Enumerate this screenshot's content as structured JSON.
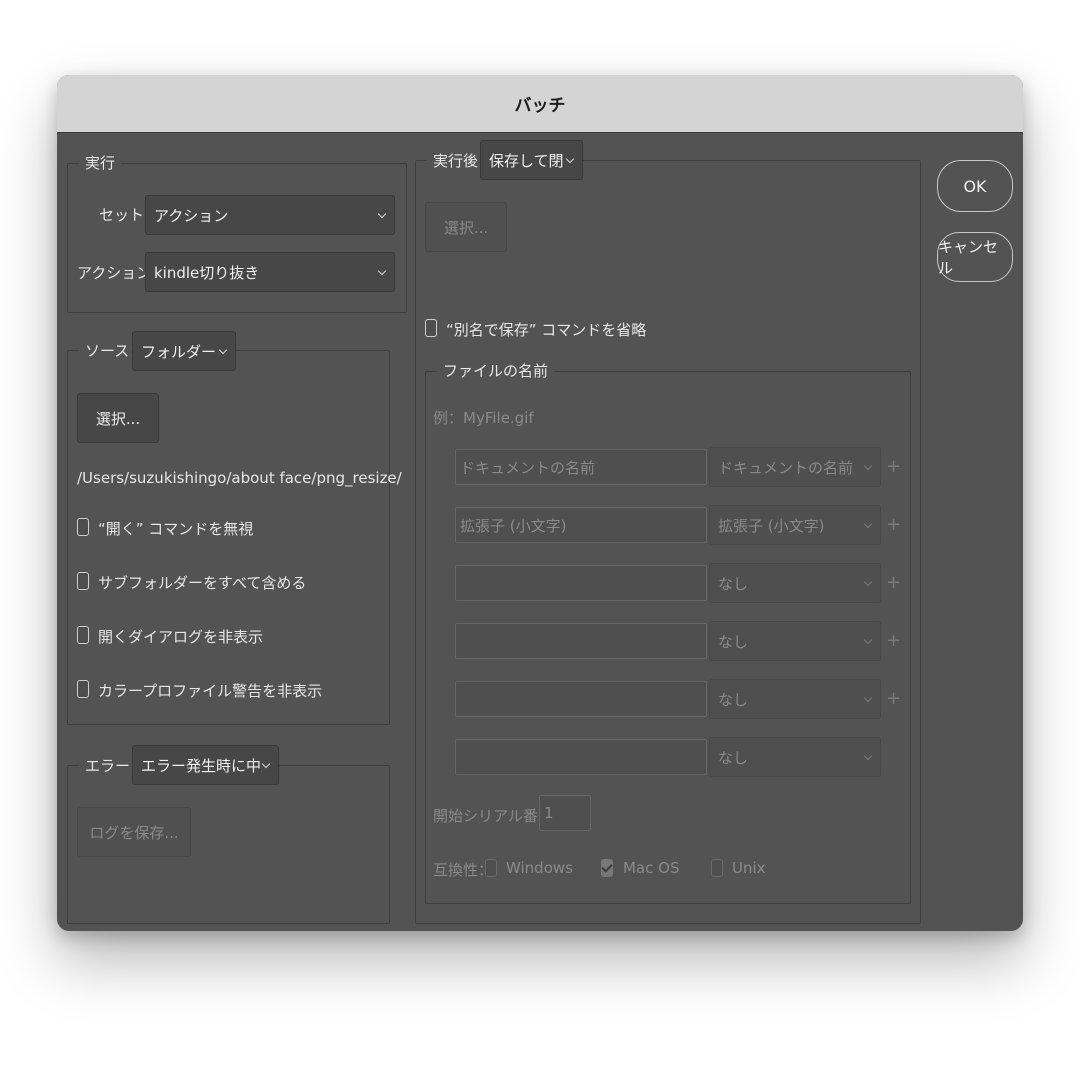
{
  "window": {
    "title": "バッチ"
  },
  "run": {
    "legend": "実行",
    "set_label": "セット：",
    "set_value": "アクション",
    "action_label": "アクション：",
    "action_value": "kindle切り抜き"
  },
  "source": {
    "label": "ソース：",
    "value": "フォルダー",
    "choose_button": "選択...",
    "path": "/Users/suzukishingo/about face/png_resize/",
    "checkboxes": [
      {
        "label": "“開く” コマンドを無視",
        "checked": false
      },
      {
        "label": "サブフォルダーをすべて含める",
        "checked": false
      },
      {
        "label": "開くダイアログを非表示",
        "checked": false
      },
      {
        "label": "カラープロファイル警告を非表示",
        "checked": false
      }
    ]
  },
  "error": {
    "label": "エラー：",
    "value": "エラー発生時に中止",
    "save_log_button": "ログを保存..."
  },
  "destination": {
    "label": "実行後：",
    "value": "保存して閉じる",
    "choose_button": "選択...",
    "override_save_as_label": "“別名で保存” コマンドを省略",
    "override_save_as_checked": false
  },
  "file_naming": {
    "legend": "ファイルの名前",
    "example": "例：MyFile.gif",
    "rows": [
      {
        "text": "ドキュメントの名前",
        "option": "ドキュメントの名前",
        "plus": "+"
      },
      {
        "text": "拡張子 (小文字)",
        "option": "拡張子 (小文字)",
        "plus": "+"
      },
      {
        "text": "",
        "option": "なし",
        "plus": "+"
      },
      {
        "text": "",
        "option": "なし",
        "plus": "+"
      },
      {
        "text": "",
        "option": "なし",
        "plus": "+"
      },
      {
        "text": "",
        "option": "なし",
        "plus": ""
      }
    ],
    "serial_label": "開始シリアル番号：",
    "serial_value": "1",
    "compat_label": "互換性：",
    "compat": [
      {
        "label": "Windows",
        "checked": false
      },
      {
        "label": "Mac OS",
        "checked": true
      },
      {
        "label": "Unix",
        "checked": false
      }
    ]
  },
  "buttons": {
    "ok": "OK",
    "cancel": "キャンセル"
  }
}
